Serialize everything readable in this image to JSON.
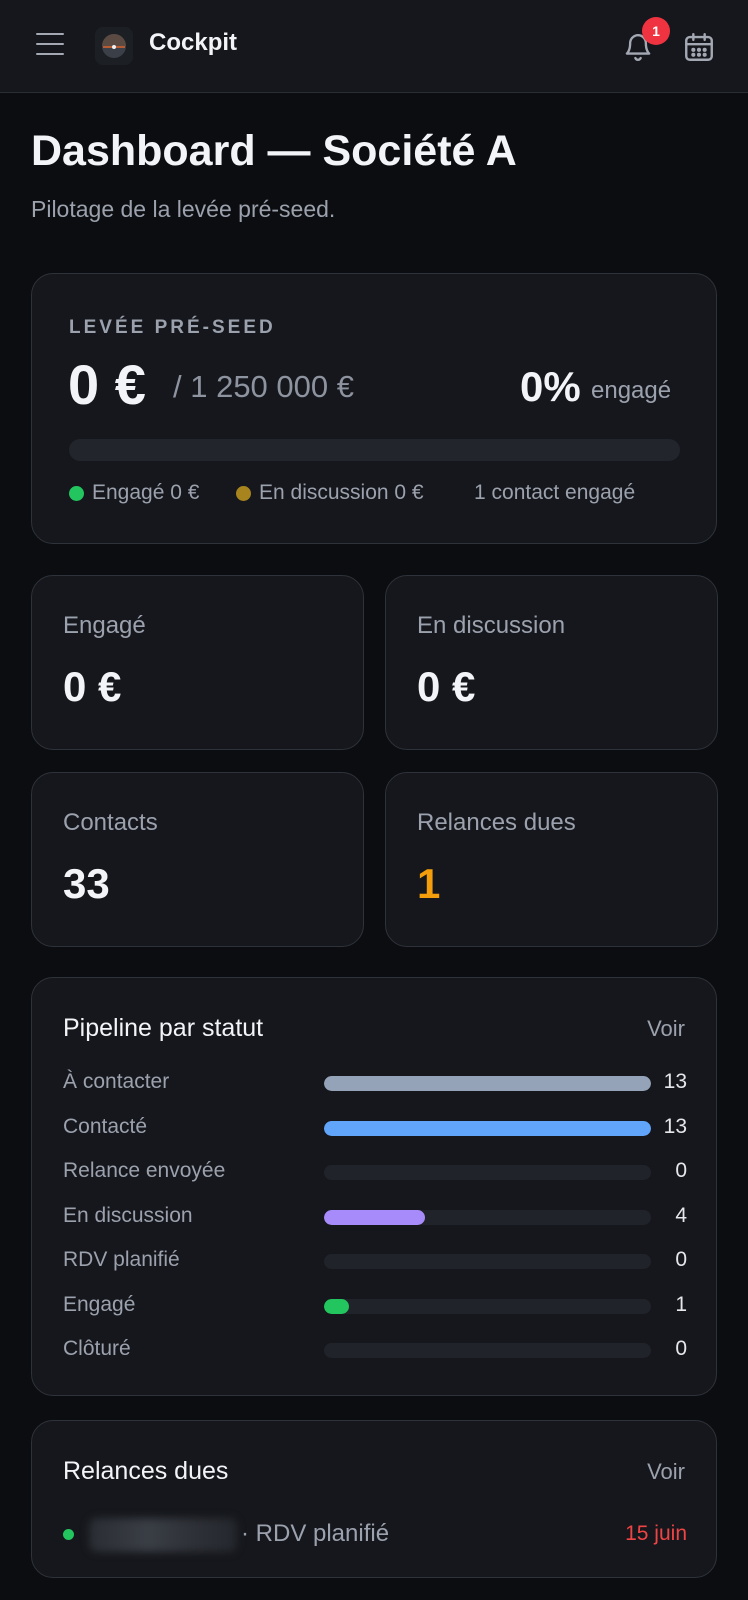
{
  "header": {
    "app_title": "Cockpit",
    "notification_count": "1"
  },
  "page": {
    "title": "Dashboard — Société A",
    "subtitle": "Pilotage de la levée pré-seed."
  },
  "raise": {
    "label": "LEVÉE PRÉ-SEED",
    "amount": "0 €",
    "target": "/ 1 250 000 €",
    "percent": "0%",
    "percent_suffix": "engagé",
    "progress_fraction": 0,
    "legend": {
      "engaged": "Engagé 0 €",
      "engaged_color": "#22c55e",
      "discussion": "En discussion 0 €",
      "discussion_color": "#a8841f",
      "contacts": "1 contact engagé"
    }
  },
  "stats": {
    "engaged": {
      "label": "Engagé",
      "value": "0 €"
    },
    "discussion": {
      "label": "En discussion",
      "value": "0 €"
    },
    "contacts": {
      "label": "Contacts",
      "value": "33"
    },
    "followups": {
      "label": "Relances dues",
      "value": "1",
      "color": "#f59e0b"
    }
  },
  "pipeline": {
    "title": "Pipeline par statut",
    "link": "Voir",
    "max": 13,
    "rows": [
      {
        "label": "À contacter",
        "count": "13",
        "value": 13,
        "color": "#94a3b8"
      },
      {
        "label": "Contacté",
        "count": "13",
        "value": 13,
        "color": "#60a5fa"
      },
      {
        "label": "Relance envoyée",
        "count": "0",
        "value": 0,
        "color": "#60a5fa"
      },
      {
        "label": "En discussion",
        "count": "4",
        "value": 4,
        "color": "#a78bfa"
      },
      {
        "label": "RDV planifié",
        "count": "0",
        "value": 0,
        "color": "#60a5fa"
      },
      {
        "label": "Engagé",
        "count": "1",
        "value": 1,
        "color": "#22c55e"
      },
      {
        "label": "Clôturé",
        "count": "0",
        "value": 0,
        "color": "#60a5fa"
      }
    ]
  },
  "followups": {
    "title": "Relances dues",
    "link": "Voir",
    "items": [
      {
        "status": "· RDV planifié",
        "date": "15 juin"
      }
    ]
  }
}
